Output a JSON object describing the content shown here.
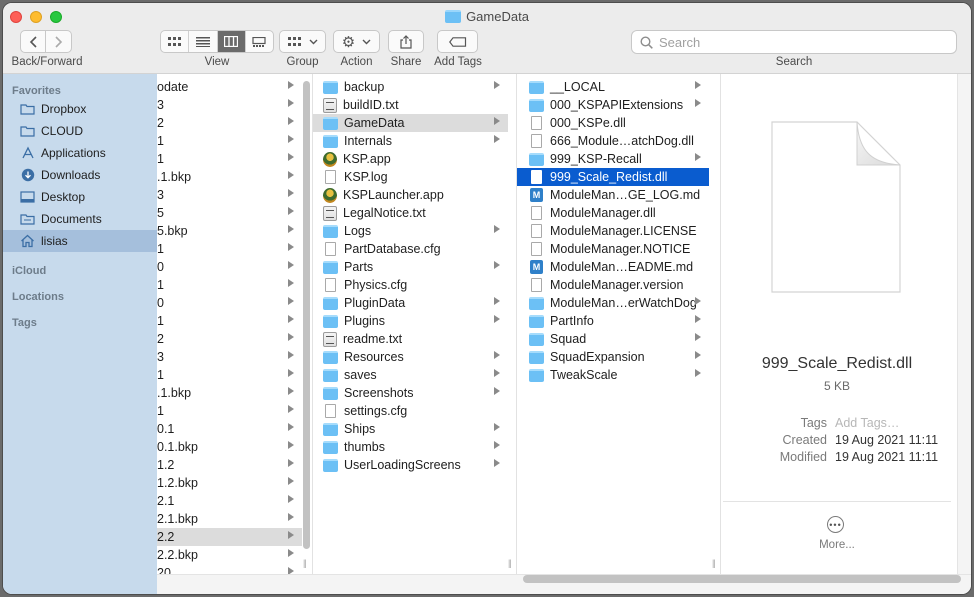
{
  "window": {
    "title": "GameData"
  },
  "toolbar": {
    "back_forward_label": "Back/Forward",
    "view_label": "View",
    "group_label": "Group",
    "action_label": "Action",
    "share_label": "Share",
    "add_tags_label": "Add Tags",
    "search_label": "Search",
    "search_placeholder": "Search"
  },
  "sidebar": {
    "favorites_header": "Favorites",
    "items": [
      {
        "label": "Dropbox",
        "icon": "folder-icon"
      },
      {
        "label": "CLOUD",
        "icon": "folder-icon"
      },
      {
        "label": "Applications",
        "icon": "applications-icon"
      },
      {
        "label": "Downloads",
        "icon": "downloads-icon"
      },
      {
        "label": "Desktop",
        "icon": "desktop-icon"
      },
      {
        "label": "Documents",
        "icon": "documents-icon"
      },
      {
        "label": "lisias",
        "icon": "home-icon",
        "selected": true
      }
    ],
    "icloud_header": "iCloud",
    "locations_header": "Locations",
    "tags_header": "Tags"
  },
  "column1": {
    "items": [
      "odate",
      "3",
      "2",
      "1",
      "1",
      ".1.bkp",
      "3",
      "5",
      "5.bkp",
      "1",
      "0",
      "1",
      "0",
      "1",
      "2",
      "3",
      "1",
      ".1.bkp",
      "1",
      "0.1",
      "0.1.bkp",
      "1.2",
      "1.2.bkp",
      "2.1",
      "2.1.bkp",
      "2.2",
      "2.2.bkp",
      "20"
    ],
    "selected_index": 25
  },
  "column2": {
    "items": [
      {
        "name": "backup",
        "type": "folder"
      },
      {
        "name": "buildID.txt",
        "type": "txt"
      },
      {
        "name": "GameData",
        "type": "folder",
        "selected": true
      },
      {
        "name": "Internals",
        "type": "folder"
      },
      {
        "name": "KSP.app",
        "type": "app"
      },
      {
        "name": "KSP.log",
        "type": "file"
      },
      {
        "name": "KSPLauncher.app",
        "type": "app"
      },
      {
        "name": "LegalNotice.txt",
        "type": "txt"
      },
      {
        "name": "Logs",
        "type": "folder"
      },
      {
        "name": "PartDatabase.cfg",
        "type": "file"
      },
      {
        "name": "Parts",
        "type": "folder"
      },
      {
        "name": "Physics.cfg",
        "type": "file"
      },
      {
        "name": "PluginData",
        "type": "folder"
      },
      {
        "name": "Plugins",
        "type": "folder"
      },
      {
        "name": "readme.txt",
        "type": "txt"
      },
      {
        "name": "Resources",
        "type": "folder"
      },
      {
        "name": "saves",
        "type": "folder"
      },
      {
        "name": "Screenshots",
        "type": "folder"
      },
      {
        "name": "settings.cfg",
        "type": "file"
      },
      {
        "name": "Ships",
        "type": "folder"
      },
      {
        "name": "thumbs",
        "type": "folder"
      },
      {
        "name": "UserLoadingScreens",
        "type": "folder"
      }
    ]
  },
  "column3": {
    "items": [
      {
        "name": "__LOCAL",
        "type": "folder"
      },
      {
        "name": "000_KSPAPIExtensions",
        "type": "folder"
      },
      {
        "name": "000_KSPe.dll",
        "type": "file"
      },
      {
        "name": "666_Module…atchDog.dll",
        "type": "file"
      },
      {
        "name": "999_KSP-Recall",
        "type": "folder"
      },
      {
        "name": "999_Scale_Redist.dll",
        "type": "file",
        "selected": true
      },
      {
        "name": "ModuleMan…GE_LOG.md",
        "type": "md"
      },
      {
        "name": "ModuleManager.dll",
        "type": "file"
      },
      {
        "name": "ModuleManager.LICENSE",
        "type": "file"
      },
      {
        "name": "ModuleManager.NOTICE",
        "type": "file"
      },
      {
        "name": "ModuleMan…EADME.md",
        "type": "md"
      },
      {
        "name": "ModuleManager.version",
        "type": "file"
      },
      {
        "name": "ModuleMan…erWatchDog",
        "type": "folder"
      },
      {
        "name": "PartInfo",
        "type": "folder"
      },
      {
        "name": "Squad",
        "type": "folder"
      },
      {
        "name": "SquadExpansion",
        "type": "folder"
      },
      {
        "name": "TweakScale",
        "type": "folder"
      }
    ]
  },
  "preview": {
    "file_name": "999_Scale_Redist.dll",
    "file_size": "5 KB",
    "tags_key": "Tags",
    "tags_placeholder": "Add Tags…",
    "created_key": "Created",
    "created_value": "19 Aug 2021 11:11",
    "modified_key": "Modified",
    "modified_value": "19 Aug 2021 11:11",
    "more_label": "More..."
  }
}
